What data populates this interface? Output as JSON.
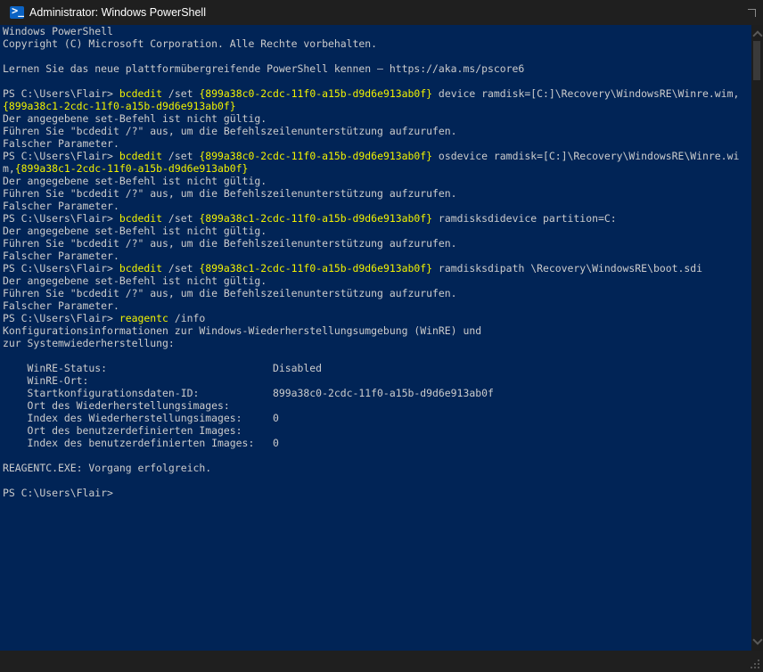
{
  "window": {
    "title": "Administrator: Windows PowerShell",
    "icon": "powershell-icon"
  },
  "console": {
    "lines": [
      [
        {
          "t": "Windows PowerShell"
        }
      ],
      [
        {
          "t": "Copyright (C) Microsoft Corporation. Alle Rechte vorbehalten."
        }
      ],
      [
        {
          "t": ""
        }
      ],
      [
        {
          "t": "Lernen Sie das neue plattformübergreifende PowerShell kennen – https://aka.ms/pscore6"
        }
      ],
      [
        {
          "t": ""
        }
      ],
      [
        {
          "t": "PS C:\\Users\\Flair> "
        },
        {
          "t": "bcdedit",
          "c": "y"
        },
        {
          "t": " /set "
        },
        {
          "t": "{899a38c0-2cdc-11f0-a15b-d9d6e913ab0f}",
          "c": "y"
        },
        {
          "t": " device ramdisk=[C:]\\Recovery\\WindowsRE\\Winre.wim,"
        }
      ],
      [
        {
          "t": "{899a38c1-2cdc-11f0-a15b-d9d6e913ab0f}",
          "c": "y"
        }
      ],
      [
        {
          "t": "Der angegebene set-Befehl ist nicht gültig."
        }
      ],
      [
        {
          "t": "Führen Sie \"bcdedit /?\" aus, um die Befehlszeilenunterstützung aufzurufen."
        }
      ],
      [
        {
          "t": "Falscher Parameter."
        }
      ],
      [
        {
          "t": "PS C:\\Users\\Flair> "
        },
        {
          "t": "bcdedit",
          "c": "y"
        },
        {
          "t": " /set "
        },
        {
          "t": "{899a38c0-2cdc-11f0-a15b-d9d6e913ab0f}",
          "c": "y"
        },
        {
          "t": " osdevice ramdisk=[C:]\\Recovery\\WindowsRE\\Winre.wi"
        }
      ],
      [
        {
          "t": "m,"
        },
        {
          "t": "{899a38c1-2cdc-11f0-a15b-d9d6e913ab0f}",
          "c": "y"
        }
      ],
      [
        {
          "t": "Der angegebene set-Befehl ist nicht gültig."
        }
      ],
      [
        {
          "t": "Führen Sie \"bcdedit /?\" aus, um die Befehlszeilenunterstützung aufzurufen."
        }
      ],
      [
        {
          "t": "Falscher Parameter."
        }
      ],
      [
        {
          "t": "PS C:\\Users\\Flair> "
        },
        {
          "t": "bcdedit",
          "c": "y"
        },
        {
          "t": " /set "
        },
        {
          "t": "{899a38c1-2cdc-11f0-a15b-d9d6e913ab0f}",
          "c": "y"
        },
        {
          "t": " ramdisksdidevice partition=C:"
        }
      ],
      [
        {
          "t": "Der angegebene set-Befehl ist nicht gültig."
        }
      ],
      [
        {
          "t": "Führen Sie \"bcdedit /?\" aus, um die Befehlszeilenunterstützung aufzurufen."
        }
      ],
      [
        {
          "t": "Falscher Parameter."
        }
      ],
      [
        {
          "t": "PS C:\\Users\\Flair> "
        },
        {
          "t": "bcdedit",
          "c": "y"
        },
        {
          "t": " /set "
        },
        {
          "t": "{899a38c1-2cdc-11f0-a15b-d9d6e913ab0f}",
          "c": "y"
        },
        {
          "t": " ramdisksdipath \\Recovery\\WindowsRE\\boot.sdi"
        }
      ],
      [
        {
          "t": "Der angegebene set-Befehl ist nicht gültig."
        }
      ],
      [
        {
          "t": "Führen Sie \"bcdedit /?\" aus, um die Befehlszeilenunterstützung aufzurufen."
        }
      ],
      [
        {
          "t": "Falscher Parameter."
        }
      ],
      [
        {
          "t": "PS C:\\Users\\Flair> "
        },
        {
          "t": "reagentc",
          "c": "y"
        },
        {
          "t": " /info"
        }
      ],
      [
        {
          "t": "Konfigurationsinformationen zur Windows-Wiederherstellungsumgebung (WinRE) und"
        }
      ],
      [
        {
          "t": "zur Systemwiederherstellung:"
        }
      ],
      [
        {
          "t": ""
        }
      ],
      [
        {
          "t": "    WinRE-Status:                           Disabled"
        }
      ],
      [
        {
          "t": "    WinRE-Ort:"
        }
      ],
      [
        {
          "t": "    Startkonfigurationsdaten-ID:            899a38c0-2cdc-11f0-a15b-d9d6e913ab0f"
        }
      ],
      [
        {
          "t": "    Ort des Wiederherstellungsimages:"
        }
      ],
      [
        {
          "t": "    Index des Wiederherstellungsimages:     0"
        }
      ],
      [
        {
          "t": "    Ort des benutzerdefinierten Images:"
        }
      ],
      [
        {
          "t": "    Index des benutzerdefinierten Images:   0"
        }
      ],
      [
        {
          "t": ""
        }
      ],
      [
        {
          "t": "REAGENTC.EXE: Vorgang erfolgreich."
        }
      ],
      [
        {
          "t": ""
        }
      ],
      [
        {
          "t": "PS C:\\Users\\Flair>"
        }
      ]
    ]
  }
}
